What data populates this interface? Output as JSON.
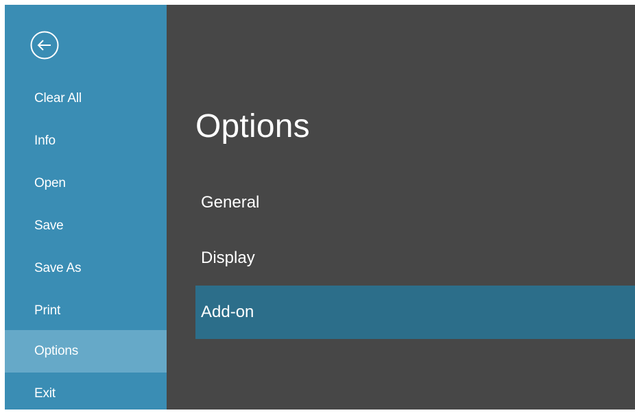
{
  "sidebar": {
    "back_icon": "back-arrow-circle-icon",
    "items": [
      {
        "label": "Clear All"
      },
      {
        "label": "Info"
      },
      {
        "label": "Open"
      },
      {
        "label": "Save"
      },
      {
        "label": "Save As"
      },
      {
        "label": "Print"
      },
      {
        "label": "Options",
        "selected": true
      },
      {
        "label": "Exit"
      }
    ]
  },
  "main": {
    "title": "Options",
    "options": [
      {
        "label": "General"
      },
      {
        "label": "Display"
      },
      {
        "label": "Add-on",
        "selected": true
      }
    ]
  },
  "colors": {
    "sidebar_bg": "#3a8db4",
    "sidebar_selected": "#66a9c8",
    "content_bg": "#474747",
    "option_selected": "#2c6e8a",
    "text": "#ffffff"
  }
}
